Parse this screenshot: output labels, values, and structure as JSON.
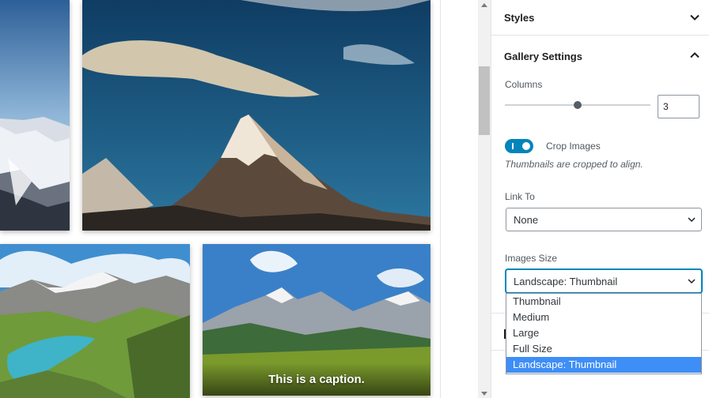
{
  "gallery": {
    "caption": "This is a caption."
  },
  "sidebar": {
    "styles_panel": {
      "title": "Styles",
      "icon": "chevron-down-icon"
    },
    "gallery_settings": {
      "title": "Gallery Settings",
      "icon": "chevron-up-icon",
      "columns": {
        "label": "Columns",
        "value": "3",
        "slider_fraction": 0.5
      },
      "crop_images": {
        "label": "Crop Images",
        "help": "Thumbnails are cropped to align.",
        "enabled": true
      },
      "link_to": {
        "label": "Link To",
        "value": "None"
      },
      "images_size": {
        "label": "Images Size",
        "value": "Landscape: Thumbnail",
        "options": [
          "Thumbnail",
          "Medium",
          "Large",
          "Full Size",
          "Landscape: Thumbnail"
        ],
        "selected_index": 4
      }
    }
  },
  "colors": {
    "accent": "#0085ba",
    "option_highlight": "#3e8ef7",
    "panel_border": "#e2e4e7"
  }
}
